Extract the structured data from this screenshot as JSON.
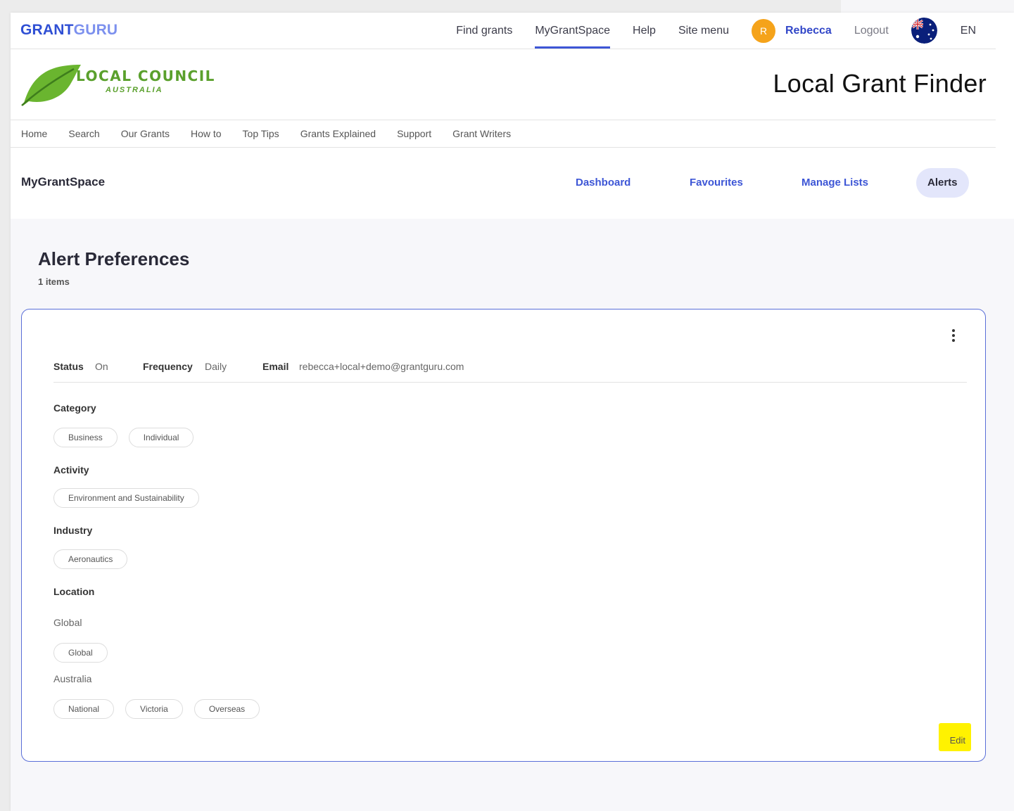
{
  "topbar": {
    "brand_part1": "GRANT",
    "brand_part2": "GURU",
    "nav": [
      "Find grants",
      "MyGrantSpace",
      "Help",
      "Site menu"
    ],
    "active_nav": "MyGrantSpace",
    "avatar_initial": "R",
    "user_name": "Rebecca",
    "logout": "Logout",
    "flag_icon": "australia-flag-icon",
    "language": "EN"
  },
  "council": {
    "name": "LOCAL COUNCIL",
    "sub": "AUSTRALIA",
    "logo_icon": "leaf-icon",
    "page_title": "Local Grant Finder"
  },
  "secondary_nav": [
    "Home",
    "Search",
    "Our Grants",
    "How to",
    "Top Tips",
    "Grants Explained",
    "Support",
    "Grant Writers"
  ],
  "mygrantspace": {
    "title": "MyGrantSpace",
    "tabs": [
      "Dashboard",
      "Favourites",
      "Manage Lists",
      "Alerts"
    ],
    "active_tab": "Alerts"
  },
  "alerts": {
    "title": "Alert Preferences",
    "count": "1 items",
    "card": {
      "status_label": "Status",
      "status_value": "On",
      "frequency_label": "Frequency",
      "frequency_value": "Daily",
      "email_label": "Email",
      "email_value": "rebecca+local+demo@grantguru.com",
      "category_label": "Category",
      "categories": [
        "Business",
        "Individual"
      ],
      "activity_label": "Activity",
      "activities": [
        "Environment and Sustainability"
      ],
      "industry_label": "Industry",
      "industries": [
        "Aeronautics"
      ],
      "location_label": "Location",
      "location_group1": "Global",
      "location_group1_items": [
        "Global"
      ],
      "location_group2": "Australia",
      "location_group2_items": [
        "National",
        "Victoria",
        "Overseas"
      ],
      "edit_label": "Edit"
    }
  },
  "colors": {
    "brand_blue": "#2f4fd4",
    "brand_light_blue": "#7c90ee",
    "council_green": "#5aa02c",
    "avatar_orange": "#f5a31a",
    "accent_blue": "#3d56d6",
    "active_tab_bg": "#e3e6fb",
    "edit_highlight": "#fff200"
  }
}
